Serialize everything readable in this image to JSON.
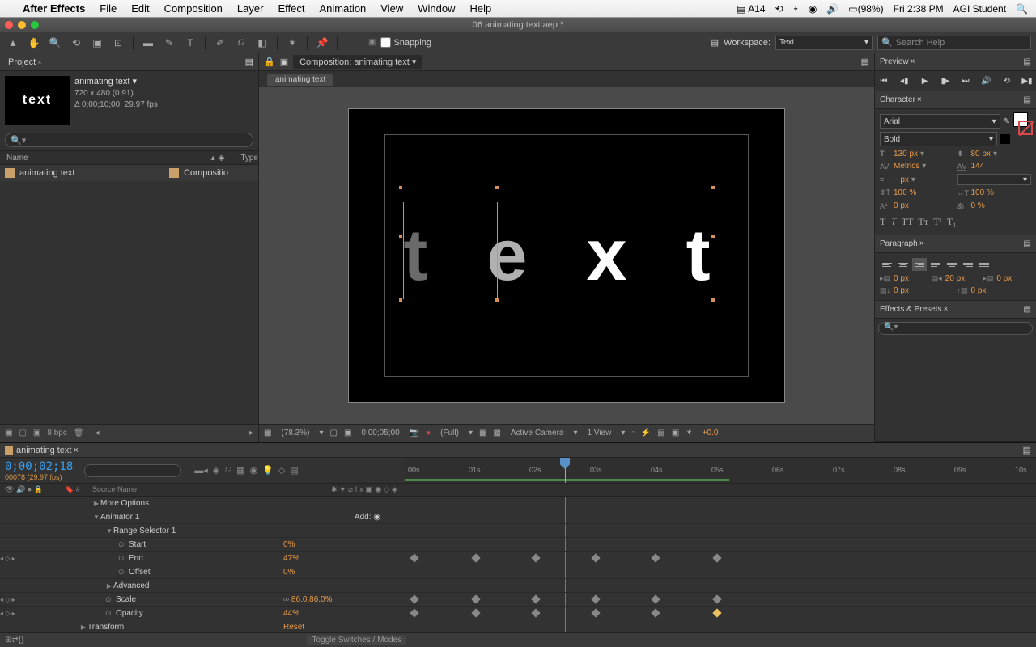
{
  "menubar": {
    "app": "After Effects",
    "items": [
      "File",
      "Edit",
      "Composition",
      "Layer",
      "Effect",
      "Animation",
      "View",
      "Window",
      "Help"
    ],
    "status": {
      "adobe": "14",
      "battery": "(98%)",
      "time": "Fri 2:38 PM",
      "user": "AGI Student"
    }
  },
  "titlebar": {
    "title": "06 animating text.aep *"
  },
  "toolbar": {
    "snapping": "Snapping",
    "workspace_label": "Workspace:",
    "workspace_value": "Text",
    "search_placeholder": "Search Help"
  },
  "project": {
    "tab": "Project",
    "comp_name": "animating text ▾",
    "dim": "720 x 480 (0.91)",
    "dur": "Δ 0;00;10;00, 29.97 fps",
    "thumb_text": "text",
    "col_name": "Name",
    "col_type": "Type",
    "items": [
      {
        "name": "animating text",
        "type": "Compositio"
      }
    ],
    "bpc": "8 bpc"
  },
  "comp_panel": {
    "header": "Composition: animating text",
    "subtab": "animating text",
    "text_chars": [
      "t",
      "e",
      "x",
      "t"
    ],
    "footer": {
      "zoom": "(78.3%)",
      "time": "0;00;05;00",
      "res": "(Full)",
      "camera": "Active Camera",
      "views": "1 View",
      "exposure": "+0.0"
    }
  },
  "preview": {
    "tab": "Preview"
  },
  "character": {
    "tab": "Character",
    "font": "Arial",
    "style": "Bold",
    "size": "130 px",
    "leading": "80 px",
    "kerning": "Metrics",
    "tracking": "144",
    "stroke_w": "– px",
    "vscale": "100 %",
    "hscale": "100 %",
    "baseline": "0 px",
    "tsume": "0 %"
  },
  "paragraph": {
    "tab": "Paragraph",
    "left": "0 px",
    "right": "20 px",
    "firstline": "0 px",
    "before": "0 px",
    "after": "0 px"
  },
  "effects": {
    "tab": "Effects & Presets"
  },
  "timeline": {
    "tab": "animating text",
    "timecode": "0;00;02;18",
    "frames": "00078 (29.97 fps)",
    "col_src": "Source Name",
    "col_num": "#",
    "ruler": [
      "00s",
      "01s",
      "02s",
      "03s",
      "04s",
      "05s",
      "06s",
      "07s",
      "08s",
      "09s",
      "10s"
    ],
    "rows": [
      {
        "indent": 3,
        "label": "More Options",
        "tw": "▶"
      },
      {
        "indent": 3,
        "label": "Animator 1",
        "tw": "▼",
        "add": "Add: ◉"
      },
      {
        "indent": 4,
        "label": "Range Selector 1",
        "tw": "▼"
      },
      {
        "indent": 5,
        "label": "Start",
        "val": "0%",
        "sw": "⊙"
      },
      {
        "indent": 5,
        "label": "End",
        "val": "47%",
        "sw": "⊙",
        "nav": true,
        "keys": [
          508,
          584,
          658,
          732,
          806,
          882
        ]
      },
      {
        "indent": 5,
        "label": "Offset",
        "val": "0%",
        "sw": "⊙"
      },
      {
        "indent": 4,
        "label": "Advanced",
        "tw": "▶"
      },
      {
        "indent": 4,
        "label": "Scale",
        "val": "86.0,86.0%",
        "sw": "⊙",
        "nav": true,
        "link": "∞",
        "keys": [
          508,
          584,
          658,
          732,
          806,
          882
        ]
      },
      {
        "indent": 4,
        "label": "Opacity",
        "val": "44%",
        "sw": "⊙",
        "nav": true,
        "keys": [
          508,
          584,
          658,
          732,
          806,
          882
        ],
        "goldkey": 882
      },
      {
        "indent": 2,
        "label": "Transform",
        "tw": "▶",
        "val": "Reset"
      }
    ],
    "footer_toggle": "Toggle Switches / Modes"
  }
}
